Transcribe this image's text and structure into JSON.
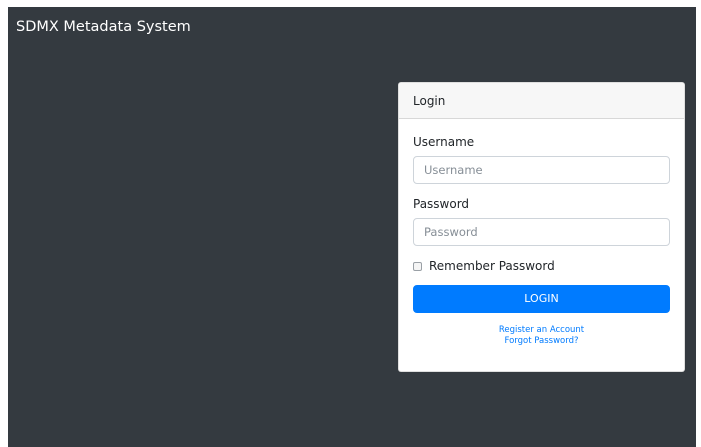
{
  "app": {
    "title": "SDMX Metadata System"
  },
  "login_card": {
    "header": "Login",
    "username": {
      "label": "Username",
      "placeholder": "Username",
      "value": ""
    },
    "password": {
      "label": "Password",
      "placeholder": "Password",
      "value": ""
    },
    "remember": {
      "label": "Remember Password",
      "checked": false
    },
    "login_button": "LOGIN",
    "links": {
      "register": "Register an Account",
      "forgot": "Forgot Password?"
    }
  },
  "colors": {
    "background": "#343a40",
    "primary": "#007bff",
    "card_header": "#f7f7f7"
  }
}
